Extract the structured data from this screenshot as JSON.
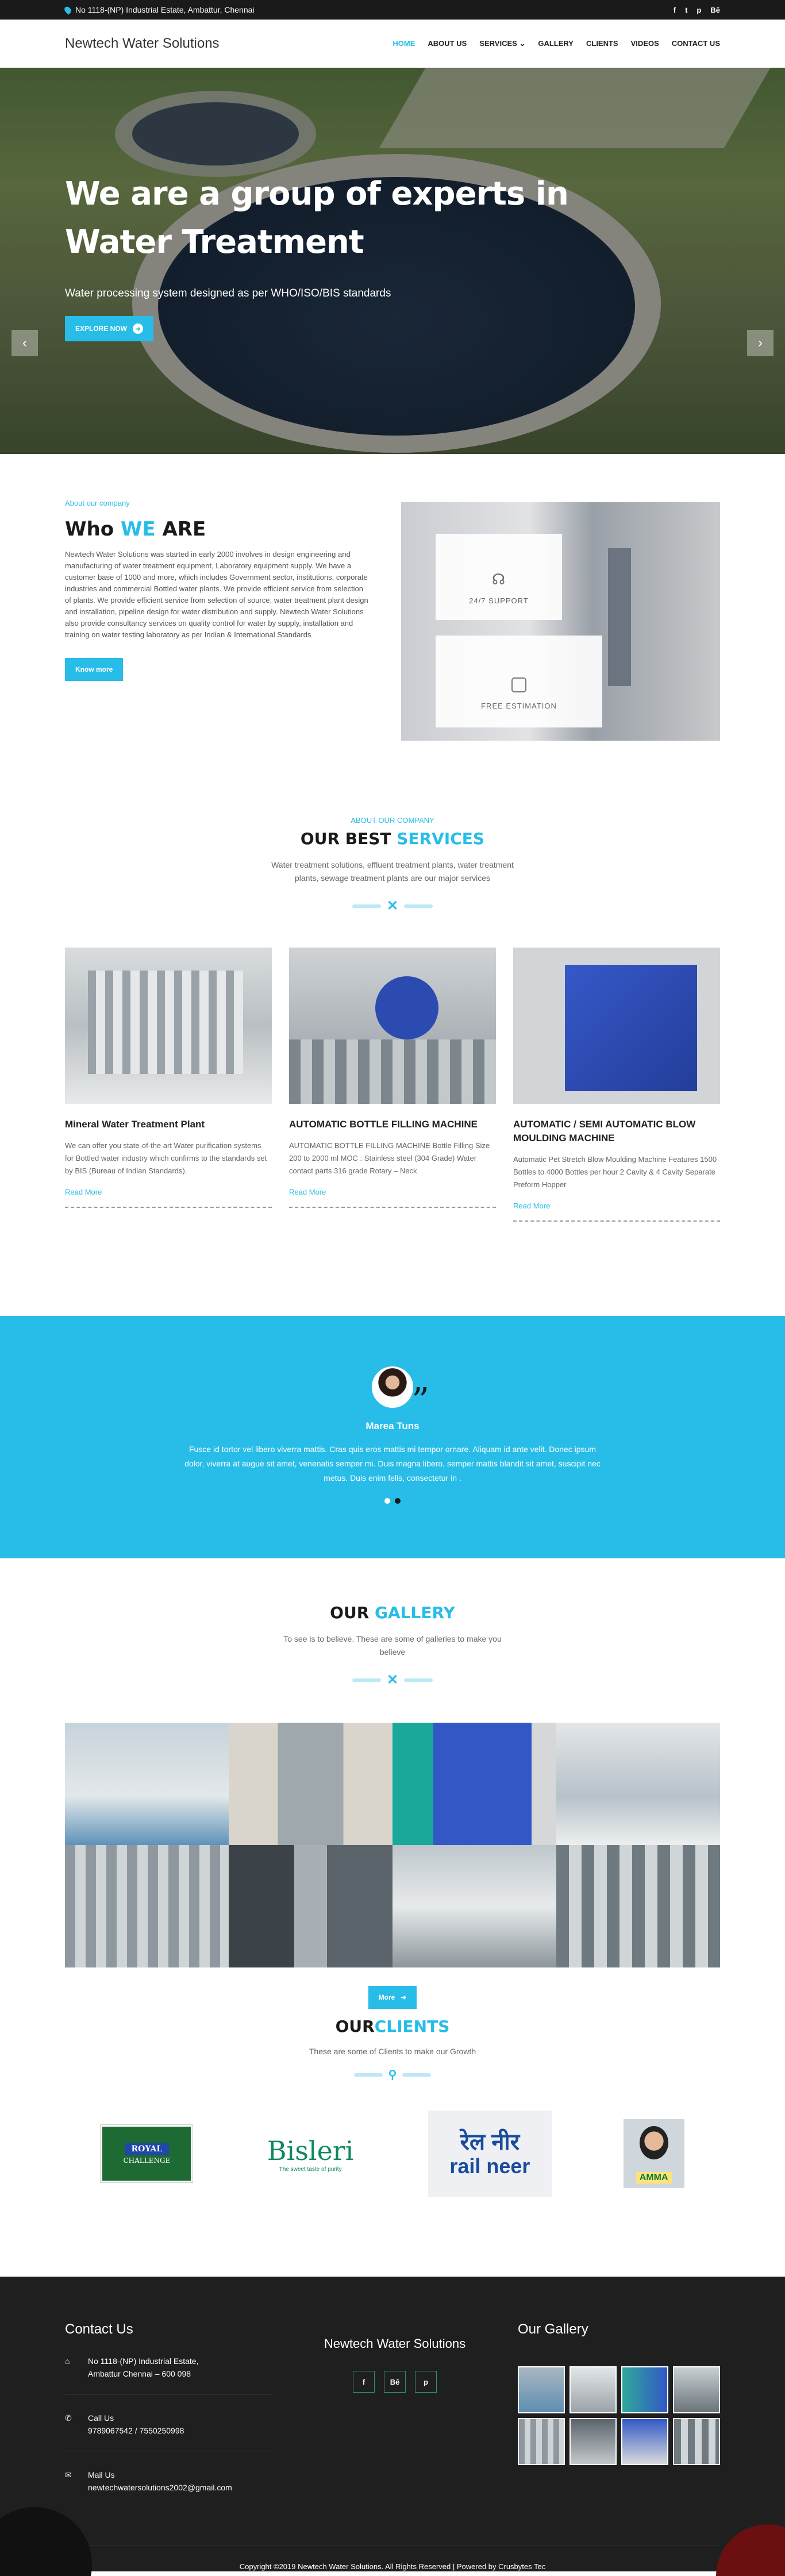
{
  "topbar": {
    "address": "No 1118-(NP) Industrial Estate, Ambattur, Chennai",
    "social": [
      "f",
      "t",
      "p",
      "Bē"
    ]
  },
  "header": {
    "logo": "Newtech Water Solutions",
    "nav": [
      "HOME",
      "ABOUT US",
      "SERVICES",
      "GALLERY",
      "CLIENTS",
      "VIDEOS",
      "CONTACT US"
    ],
    "nav_caret": "⌄"
  },
  "hero": {
    "title_line1": "We are a group of experts in",
    "title_line2": "Water Treatment",
    "subtitle": "Water processing system designed as per WHO/ISO/BIS standards",
    "button": "EXPLORE NOW",
    "prev": "‹",
    "next": "›"
  },
  "about": {
    "kicker": "About our company",
    "title_a": "Who ",
    "title_b": "WE",
    "title_c": " ARE",
    "text": "Newtech Water Solutions was started in early 2000 involves in design engineering and manufacturing of water treatment equipment, Laboratory equipment supply. We have a customer base of 1000 and more, which includes Government sector, institutions, corporate industries and commercial Bottled water plants. We provide efficient service from selection of plants. We provide efficient service from selection of source, water treatment plant design and installation, pipeline design for water distribution and supply. Newtech Water Solutions also provide consultancy services on quality control for water by supply, installation and training on water testing laboratory as per Indian & International Standards",
    "button": "Know more",
    "box1": "24/7 SUPPORT",
    "box2": "FREE ESTIMATION"
  },
  "services": {
    "kicker": "ABOUT OUR COMPANY",
    "title_a": "OUR BEST ",
    "title_b": "SERVICES",
    "subtitle": "Water treatment solutions, effluent treatment plants, water treatment plants, sewage treatment plants are our major services",
    "cards": [
      {
        "title": "Mineral Water Treatment Plant",
        "text": "We can offer you state-of-the art Water purification systems for Bottled water industry which confirms to the standards set by BIS (Bureau of Indian Standards).",
        "link": "Read More"
      },
      {
        "title": "AUTOMATIC BOTTLE FILLING MACHINE",
        "text": "AUTOMATIC BOTTLE FILLING MACHINE Bottle Filling Size 200 to 2000 ml MOC : Stainless steel (304 Grade) Water contact parts 316 grade Rotary – Neck",
        "link": "Read More"
      },
      {
        "title": "AUTOMATIC / SEMI AUTOMATIC BLOW MOULDING MACHINE",
        "text": "Automatic Pet Stretch Blow Moulding Machine Features 1500 Bottles to 4000 Bottles per hour 2 Cavity & 4 Cavity Separate Preform Hopper",
        "link": "Read More"
      }
    ]
  },
  "testimonial": {
    "name": "Marea Tuns",
    "quote_mark": "”",
    "text": "Fusce id tortor vel libero viverra mattis. Cras quis eros mattis mi tempor ornare. Aliquam id ante velit. Donec ipsum dolor, viverra at augue sit amet, venenatis semper mi. Duis magna libero, semper mattis blandit sit amet, suscipit nec metus. Duis enim felis, consectetur in ."
  },
  "gallery": {
    "title_a": "OUR ",
    "title_b": "GALLERY",
    "subtitle": "To see is to believe. These are some of galleries to make you believe",
    "button": "More"
  },
  "clients": {
    "title_a": "OUR",
    "title_b": "CLIENTS",
    "subtitle": "These are some of Clients to make our Growth",
    "logos": {
      "royal_line1": "ROYAL",
      "royal_line2": "CHALLENGE",
      "bisleri": "Bisleri",
      "bisleri_tag": "The sweet taste of purity",
      "railneer_hindi": "रेल नीर",
      "railneer_en": "rail neer",
      "amma": "AMMA"
    }
  },
  "footer": {
    "contact_title": "Contact Us",
    "address_line1": "No 1118-(NP) Industrial Estate,",
    "address_line2": "Ambattur Chennai – 600 098",
    "call_label": "Call Us",
    "call_value": "9789067542 / 7550250998",
    "mail_label": "Mail Us",
    "mail_value": "newtechwatersolutions2002@gmail.com",
    "brand": "Newtech Water Solutions",
    "social": [
      "f",
      "Bē",
      "p"
    ],
    "gallery_title": "Our Gallery",
    "copyright": "Copyright ©2019 Newtech Water Solutions. All Rights Reserved | Powered by Crusbytes Tec"
  },
  "colors": {
    "accent": "#27bde8",
    "dark": "#1a1a1a",
    "footer": "#1f1f1f"
  }
}
